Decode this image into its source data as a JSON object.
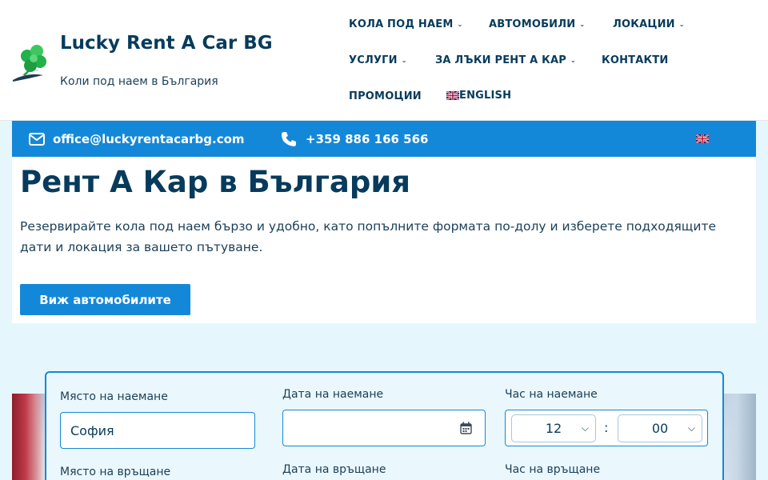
{
  "header": {
    "site_title": "Lucky Rent A Car BG",
    "tagline": "Коли под наем в България"
  },
  "nav": {
    "rent": "КОЛА ПОД НАЕМ",
    "cars": "АВТОМОБИЛИ",
    "locations": "ЛОКАЦИИ",
    "services": "УСЛУГИ",
    "about": "ЗА ЛЪКИ РЕНТ А КАР",
    "contacts": "КОНТАКТИ",
    "promotions": "ПРОМОЦИИ",
    "english": "ENGLISH"
  },
  "topbar": {
    "email": "office@luckyrentacarbg.com",
    "phone": "+359 886 166 566"
  },
  "hero": {
    "title": "Рент А Кар в България",
    "text": "Резервирайте кола под наем бързо и удобно, като попълните формата по-долу и изберете подходящите дати и локация за вашето пътуване.",
    "cta": "Виж автомобилите"
  },
  "form": {
    "pickup_place_label": "Място на наемане",
    "pickup_place_value": "София",
    "pickup_date_label": "Дата на наемане",
    "pickup_date_value": "",
    "pickup_time_label": "Час на наемане",
    "pickup_hour": "12",
    "pickup_minute": "00",
    "time_separator": ":",
    "return_place_label": "Място на връщане",
    "return_date_label": "Дата на връщане",
    "return_time_label": "Час на връщане"
  },
  "colors": {
    "primary": "#1488d8",
    "dark_text": "#073b5c",
    "light_bg": "#e6f6fd"
  },
  "icons": {
    "logo": "clover-logo-icon",
    "email": "envelope-icon",
    "phone": "phone-icon",
    "calendar": "calendar-icon",
    "flag": "uk-flag-icon"
  }
}
